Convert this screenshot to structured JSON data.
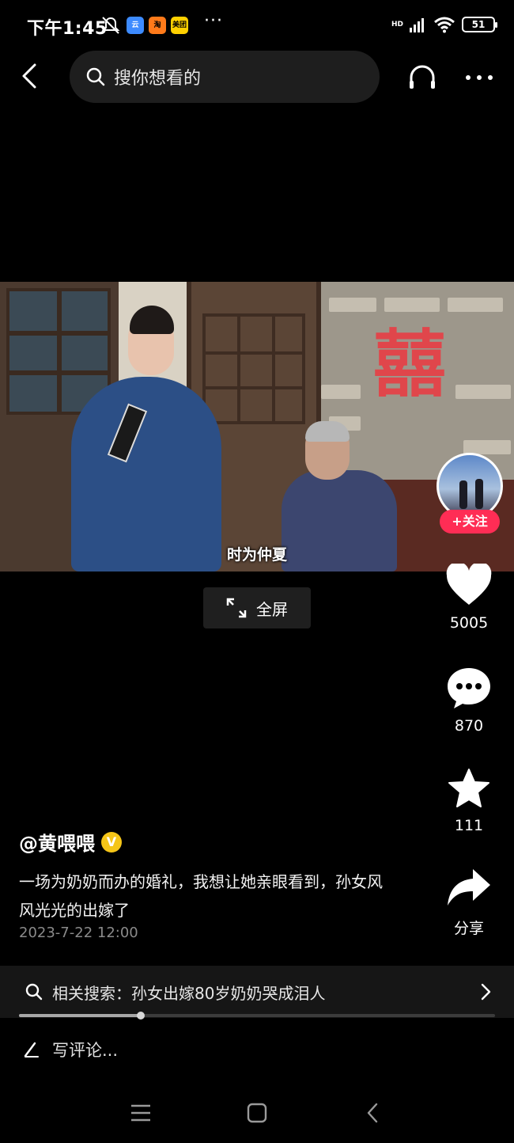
{
  "status_bar": {
    "time": "下午1:45",
    "app_badges": [
      "云",
      "淘",
      "美团"
    ],
    "overflow": "···",
    "network": "HD",
    "battery": "51"
  },
  "top_nav": {
    "search_placeholder": "搜你想看的"
  },
  "video": {
    "subtitle": "时为仲夏",
    "wall_character": "囍",
    "progress": 0.255
  },
  "fullscreen": {
    "label": "全屏"
  },
  "creator": {
    "follow_label": "+关注"
  },
  "actions": {
    "like_count": "5005",
    "comment_count": "870",
    "favorite_count": "111",
    "share_label": "分享"
  },
  "caption": {
    "author": "@黄喂喂",
    "verified_mark": "V",
    "description": "一场为奶奶而办的婚礼，我想让她亲眼看到，孙女风风光光的出嫁了",
    "date": "2023-7-22 12:00"
  },
  "related_search": {
    "text": "相关搜索：孙女出嫁80岁奶奶哭成泪人"
  },
  "comment": {
    "placeholder": "写评论..."
  },
  "colors": {
    "accent_follow": "#ff2d55",
    "verify_badge": "#f5c518",
    "background": "#000000"
  }
}
